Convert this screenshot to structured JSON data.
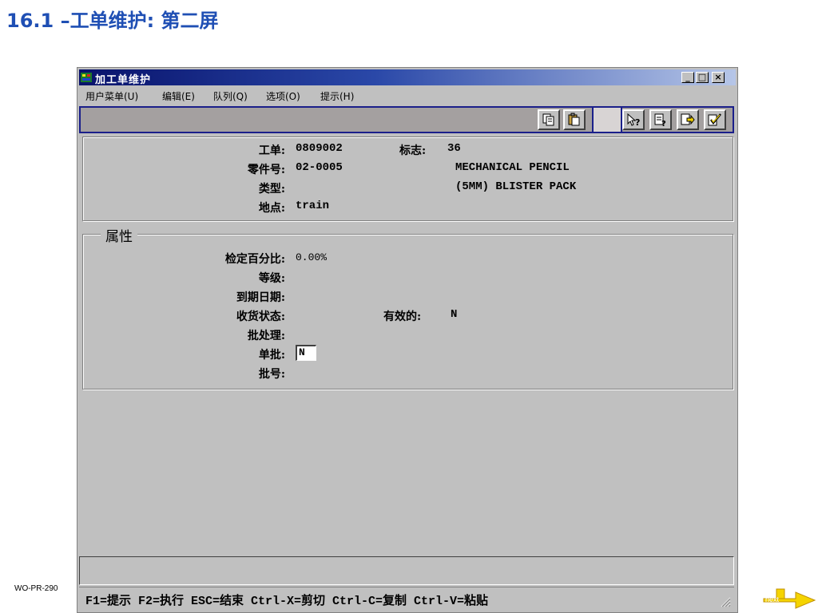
{
  "slide": {
    "title": "16.1 –工单维护: 第二屏",
    "footer_code": "WO-PR-290",
    "next_label": "next"
  },
  "window": {
    "title": "加工单维护",
    "controls": {
      "minimize": "_",
      "maximize": "□",
      "close": "×"
    }
  },
  "menu": {
    "items": [
      {
        "label": "用户菜单(U)"
      },
      {
        "label": "编辑(E)"
      },
      {
        "label": "队列(Q)"
      },
      {
        "label": "选项(O)"
      },
      {
        "label": "提示(H)"
      }
    ]
  },
  "toolbar": {
    "icons": [
      "copy-icon",
      "paste-icon",
      "help-question-icon",
      "field-help-icon",
      "go-forward-icon",
      "execute-check-icon"
    ]
  },
  "header_panel": {
    "work_order_label": "工单:",
    "work_order_value": "0809002",
    "flag_label": "标志:",
    "flag_value": "36",
    "part_label": "零件号:",
    "part_value": "02-0005",
    "desc_line1": "MECHANICAL PENCIL",
    "desc_line2": "(5MM) BLISTER PACK",
    "type_label": "类型:",
    "type_value": "",
    "site_label": "地点:",
    "site_value": "train"
  },
  "attributes_panel": {
    "title": "属性",
    "inspect_pct_label": "检定百分比:",
    "inspect_pct_value": "0.00%",
    "grade_label": "等级:",
    "grade_value": "",
    "expire_label": "到期日期:",
    "expire_value": "",
    "receipt_status_label": "收货状态:",
    "receipt_status_value": "",
    "active_label": "有效的:",
    "active_value": "N",
    "batch_label": "批处理:",
    "batch_value": "",
    "single_lot_label": "单批:",
    "single_lot_value": "N",
    "lot_number_label": "批号:",
    "lot_number_value": ""
  },
  "status_bar": {
    "text": "F1=提示 F2=执行 ESC=结束 Ctrl-X=剪切 Ctrl-C=复制 Ctrl-V=粘贴"
  },
  "colors": {
    "title_blue": "#1f4fb4",
    "titlebar_dark": "#08126b",
    "window_gray": "#c0c0c0",
    "arrow_yellow": "#f5d400"
  }
}
